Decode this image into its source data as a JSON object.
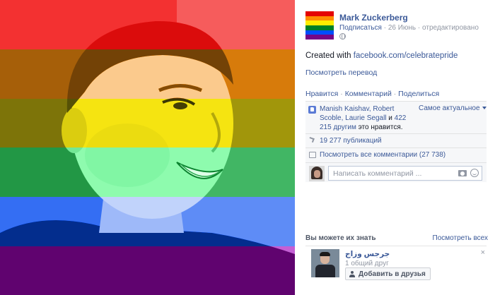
{
  "photo": {
    "rainbow_colors": [
      "#e40303",
      "#ff8c00",
      "#ffed00",
      "#008026",
      "#004dff",
      "#750787"
    ]
  },
  "post": {
    "author": "Mark Zuckerberg",
    "follow_label": "Подписаться",
    "date": "26 Июнь",
    "edited": "отредактировано",
    "text_prefix": "Created with",
    "text_link": "facebook.com/celebratepride",
    "translate": "Посмотреть перевод"
  },
  "actions": {
    "like": "Нравится",
    "comment": "Комментарий",
    "share": "Поделиться"
  },
  "ufi": {
    "likers": "Manish Kaishav, Robert Scoble, Laurie Segall",
    "and": "и",
    "others": "422 215 другим",
    "likes_suffix": "это нравится.",
    "sort_label": "Самое актуальное",
    "shares": "19 277 публикаций",
    "view_comments": "Посмотреть все комментарии (27 738)",
    "comment_placeholder": "Написать комментарий ..."
  },
  "pymk": {
    "title": "Вы можете их знать",
    "see_all": "Посмотреть всех",
    "person_name": "جرجس وزاج",
    "mutual": "1 общий друг",
    "add_friend": "Добавить в друзья",
    "close": "×"
  }
}
